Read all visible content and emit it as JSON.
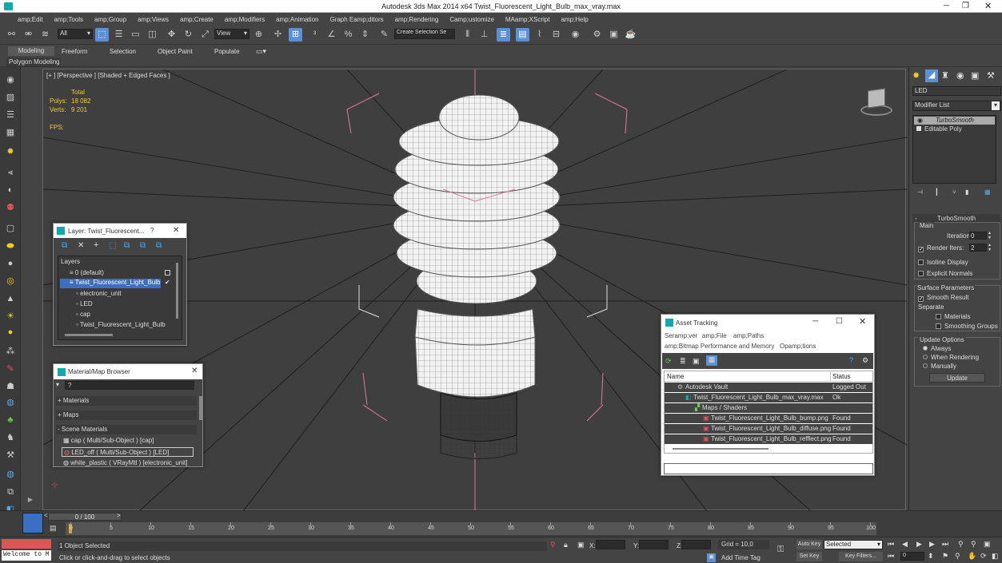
{
  "app": {
    "title": "Autodesk 3ds Max  2014 x64     Twist_Fluorescent_Light_Bulb_max_vray.max"
  },
  "menu": [
    "amp;Edit",
    "amp;Tools",
    "amp;Group",
    "amp;Views",
    "amp;Create",
    "amp;Modifiers",
    "amp;Animation",
    "Graph Eamp;ditors",
    "amp;Rendering",
    "Camp;ustomize",
    "MAamp;XScript",
    "amp;Help"
  ],
  "toolbar": {
    "selection_filter": "All",
    "ref_coord": "View",
    "named_sel": "Create Selection Se"
  },
  "ribbon": {
    "tabs": [
      "Modeling",
      "Freeform",
      "Selection",
      "Object Paint",
      "Populate"
    ],
    "sub": "Polygon Modeling"
  },
  "viewport": {
    "label": "[+ ] [Perspective ] [Shaded + Edged Faces ]",
    "stats_total": "Total",
    "polys_label": "Polys:",
    "polys_value": "18 082",
    "verts_label": "Verts:",
    "verts_value": "9 201",
    "fps_label": "FPS:"
  },
  "layer_window": {
    "title": "Layer: Twist_Fluorescent...",
    "help": "?",
    "header": "Layers",
    "items": [
      "0 (default)",
      "Twist_Fluorescent_Light_Bulb",
      "electronic_unit",
      "LED",
      "cap",
      "Twist_Fluorescent_Light_Bulb"
    ]
  },
  "material_browser": {
    "title": "Material/Map Browser",
    "search_value": "?",
    "groups": [
      "+ Materials",
      "+ Maps",
      "- Scene Materials"
    ],
    "items": [
      "cap  ( Multi/Sub-Object ) [cap]",
      "LED_off  ( Multi/Sub-Object ) [LED]",
      "white_plastic  ( VRayMtl ) [electronic_unit]"
    ]
  },
  "asset_tracking": {
    "title": "Asset Tracking",
    "menu": [
      "Seramp;ver",
      "amp;File",
      "amp;Paths",
      "amp;Bitmap Performance and Memory",
      "Opamp;tions"
    ],
    "col_name": "Name",
    "col_status": "Status",
    "rows": [
      {
        "name": "Autodesk Vault",
        "status": "Logged Out ..."
      },
      {
        "name": "Twist_Fluorescent_Light_Bulb_max_vray.max",
        "status": "Ok"
      },
      {
        "name": "Maps / Shaders",
        "status": ""
      },
      {
        "name": "Twist_Fluorescent_Light_Bulb_bump.png",
        "status": "Found"
      },
      {
        "name": "Twist_Fluorescent_Light_Bulb_diffuse.png",
        "status": "Found"
      },
      {
        "name": "Twist_Fluorescent_Light_Bulb_refflect.png",
        "status": "Found"
      }
    ]
  },
  "command_panel": {
    "object_name": "LED",
    "modifier_list": "Modifier List",
    "stack": [
      "TurboSmooth",
      "Editable Poly"
    ],
    "rollout": "TurboSmooth",
    "main": "Main",
    "iterations_label": "Iterations:",
    "iterations_value": "0",
    "render_iters_label": "Render Iters:",
    "render_iters_value": "2",
    "isoline": "Isoline Display",
    "explicit": "Explicit Normals",
    "surface_params": "Surface Parameters",
    "smooth_result": "Smooth Result",
    "separate": "Separate",
    "materials": "Materials",
    "smoothing_groups": "Smoothing Groups",
    "update_options": "Update Options",
    "always": "Always",
    "when_rendering": "When Rendering",
    "manually": "Manually",
    "update": "Update"
  },
  "timeline": {
    "frame_label": "0 / 100",
    "ticks": [
      "0",
      "5",
      "10",
      "15",
      "20",
      "25",
      "30",
      "35",
      "40",
      "45",
      "50",
      "55",
      "60",
      "65",
      "70",
      "75",
      "80",
      "85",
      "90",
      "95",
      "100"
    ]
  },
  "status": {
    "script_listener": "Welcome to M",
    "selected": "1 Object Selected",
    "prompt": "Click or click-and-drag to select objects",
    "x_label": "X:",
    "y_label": "Y:",
    "z_label": "Z:",
    "grid": "Grid = 10,0",
    "add_time_tag": "Add Time Tag",
    "auto_key": "Auto Key",
    "selected_dropdown": "Selected",
    "set_key": "Set Key",
    "key_filters": "Key Filters...",
    "frame_value": "0"
  }
}
